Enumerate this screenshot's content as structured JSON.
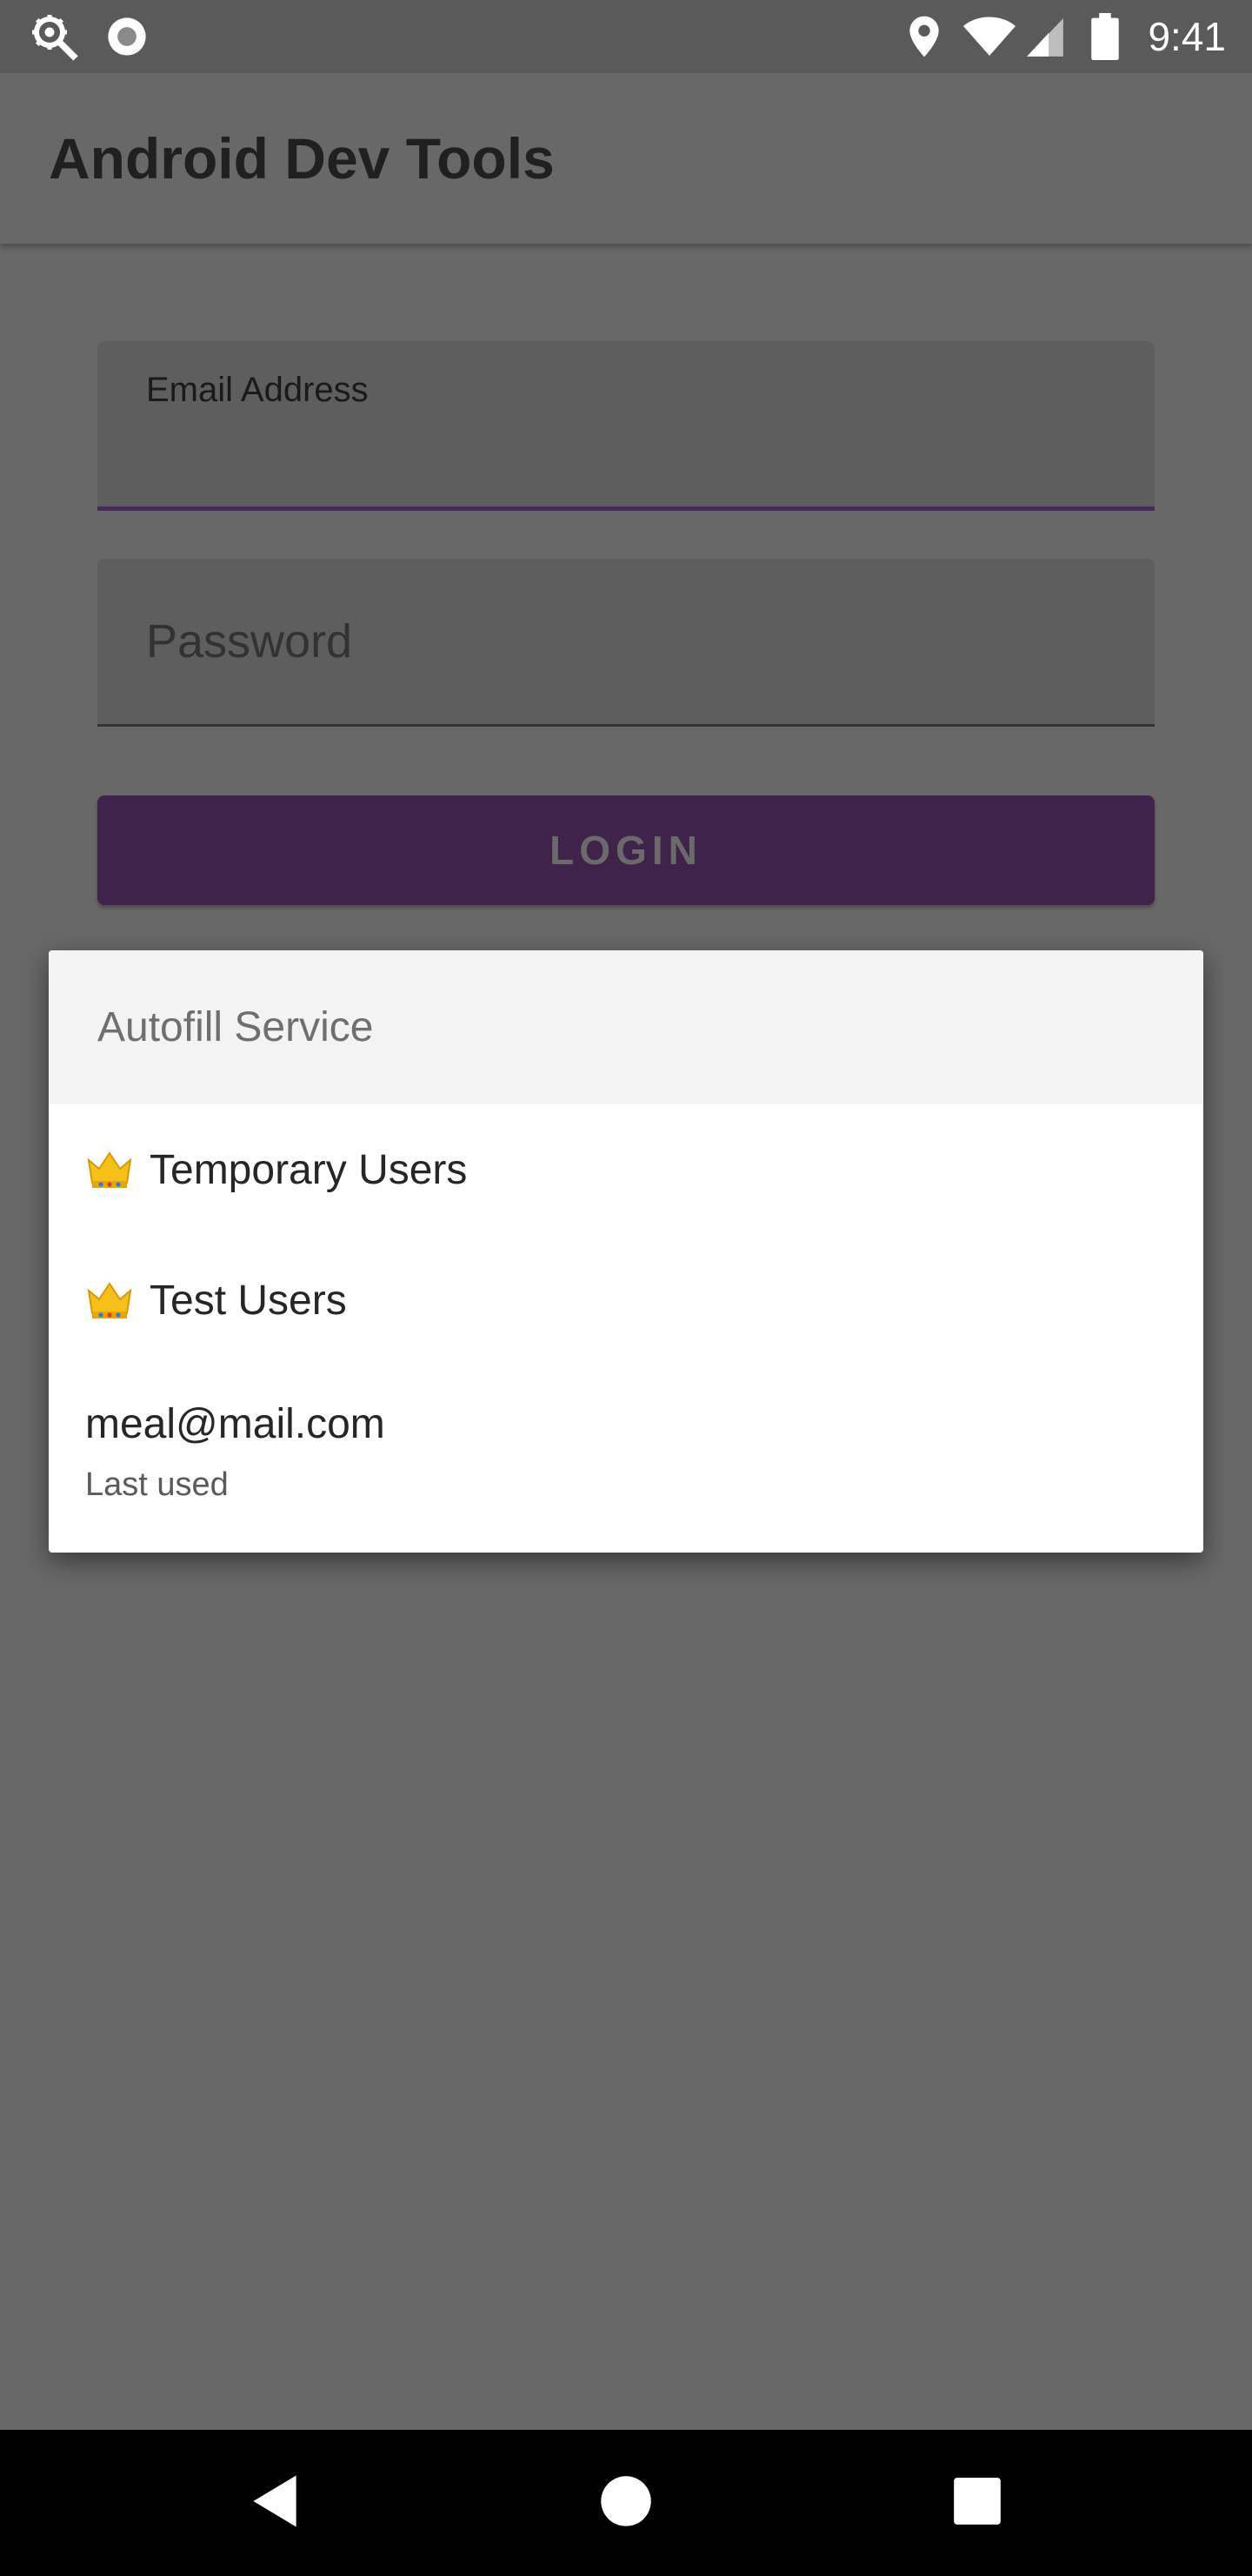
{
  "status_bar": {
    "time": "9:41",
    "icons": [
      "settings-search-icon",
      "record-icon",
      "location-icon",
      "wifi-icon",
      "signal-icon",
      "battery-icon"
    ]
  },
  "app_bar": {
    "title": "Android Dev Tools"
  },
  "form": {
    "email": {
      "label": "Email Address",
      "value": ""
    },
    "password": {
      "placeholder": "Password"
    },
    "login_label": "LOGIN"
  },
  "autofill": {
    "header": "Autofill Service",
    "items": [
      {
        "label": "Temporary Users",
        "icon": "crown-icon"
      },
      {
        "label": "Test Users",
        "icon": "crown-icon"
      },
      {
        "label": "meal@mail.com",
        "sublabel": "Last used"
      }
    ]
  },
  "nav_bar": {
    "buttons": [
      "back-icon",
      "home-icon",
      "recents-icon"
    ]
  },
  "colors": {
    "scrim_background": "#686868",
    "login_button": "#40234a",
    "email_underline": "#4a2a5c",
    "popup_header": "#f3f3f3"
  }
}
